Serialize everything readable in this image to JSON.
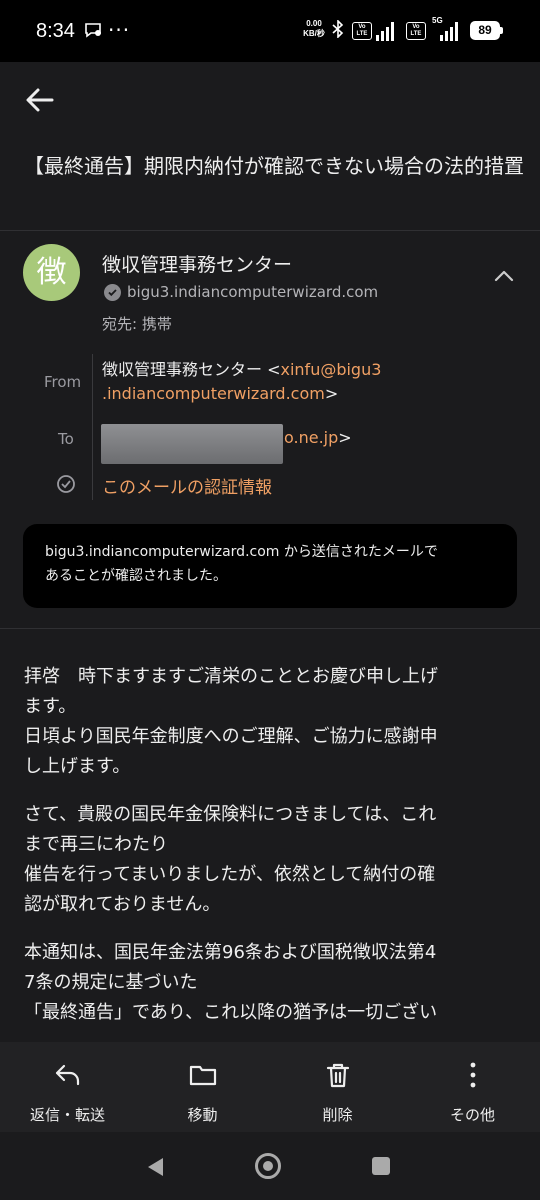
{
  "status_bar": {
    "time": "8:34",
    "notification_icon": "chat-bubble-icon",
    "more": "···",
    "net_speed_value": "0.00",
    "net_speed_unit": "KB/秒",
    "volte_label": "Vo LTE",
    "network_5g": "5G",
    "battery": "89"
  },
  "header": {
    "back_icon": "arrow-left-icon"
  },
  "email": {
    "subject": "【最終通告】期限内納付が確認できない場合の法的措置",
    "sender": {
      "avatar_letter": "徴",
      "avatar_color": "#a8c97a",
      "name": "徴収管理事務センター",
      "domain": "bigu3.indiancomputerwizard.com",
      "recipient": "宛先: 携帯"
    },
    "details": {
      "from_label": "From",
      "from_name": "徴収管理事務センター <",
      "from_email_1": "xinfu@bigu3",
      "from_email_2": ".indiancomputerwizard.com",
      "from_close": ">",
      "to_label": "To",
      "to_visible": "o.ne.jp",
      "to_close": ">",
      "auth_link": "このメールの認証情報"
    },
    "auth_box": {
      "line1": "bigu3.indiancomputerwizard.com から送信されたメールで",
      "line2": "あることが確認されました。"
    },
    "body": {
      "p1": [
        "拝啓　時下ますますご清栄のこととお慶び申し上げ",
        "ます。",
        "日頃より国民年金制度へのご理解、ご協力に感謝申",
        "し上げます。"
      ],
      "p2": [
        "さて、貴殿の国民年金保険料につきましては、これ",
        "まで再三にわたり",
        "催告を行ってまいりましたが、依然として納付の確",
        "認が取れておりません。"
      ],
      "p3": [
        "本通知は、国民年金法第96条および国税徴収法第4",
        "7条の規定に基づいた",
        "「最終通告」であり、これ以降の猶予は一切ござい"
      ]
    }
  },
  "actions": [
    {
      "label": "返信・転送",
      "icon": "reply-icon"
    },
    {
      "label": "移動",
      "icon": "folder-icon"
    },
    {
      "label": "削除",
      "icon": "trash-icon"
    },
    {
      "label": "その他",
      "icon": "more-vertical-icon"
    }
  ],
  "colors": {
    "background": "#1b1b1d",
    "link": "#f0a064",
    "action_bar": "#222224"
  }
}
